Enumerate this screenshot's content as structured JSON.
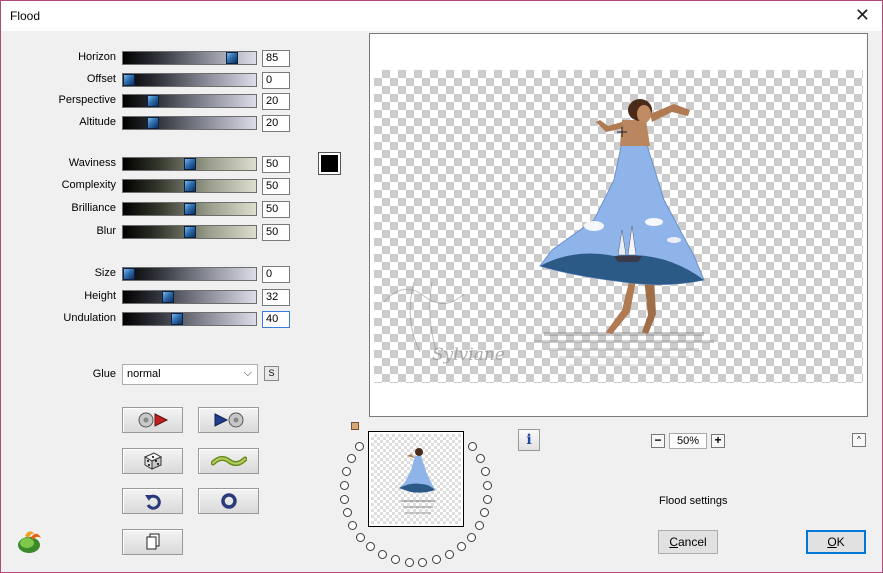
{
  "window": {
    "title": "Flood",
    "close_glyph": "✕"
  },
  "groups": [
    {
      "style": "blue",
      "params": [
        {
          "label": "Horizon",
          "value": "85",
          "level": 0.85
        },
        {
          "label": "Offset",
          "value": "0",
          "level": 0
        },
        {
          "label": "Perspective",
          "value": "20",
          "level": 0.2
        },
        {
          "label": "Altitude",
          "value": "20",
          "level": 0.2
        }
      ]
    },
    {
      "style": "olive",
      "params": [
        {
          "label": "Waviness",
          "value": "50",
          "level": 0.5
        },
        {
          "label": "Complexity",
          "value": "50",
          "level": 0.5
        },
        {
          "label": "Brilliance",
          "value": "50",
          "level": 0.5
        },
        {
          "label": "Blur",
          "value": "50",
          "level": 0.5
        }
      ]
    },
    {
      "style": "blue",
      "params": [
        {
          "label": "Size",
          "value": "0",
          "level": 0
        },
        {
          "label": "Height",
          "value": "32",
          "level": 0.32
        },
        {
          "label": "Undulation",
          "value": "40",
          "level": 0.4
        }
      ]
    }
  ],
  "color_swatch": "#000000",
  "glue": {
    "label": "Glue",
    "value": "normal",
    "s_button": "S"
  },
  "tools": [
    "play-forward-button",
    "play-back-button",
    "randomize-dice-button",
    "wave-button",
    "undo-button",
    "reset-button",
    "copy-button"
  ],
  "preview": {
    "watermark": "Sylviane"
  },
  "info_label": "i",
  "zoom": {
    "value": "50%",
    "minus": "−",
    "plus": "+"
  },
  "collapse_glyph": "^",
  "status": "Flood settings",
  "buttons": {
    "cancel": "Cancel",
    "ok": "OK"
  },
  "colors": {
    "accent": "#0078d7",
    "frame": "#b04a78"
  }
}
